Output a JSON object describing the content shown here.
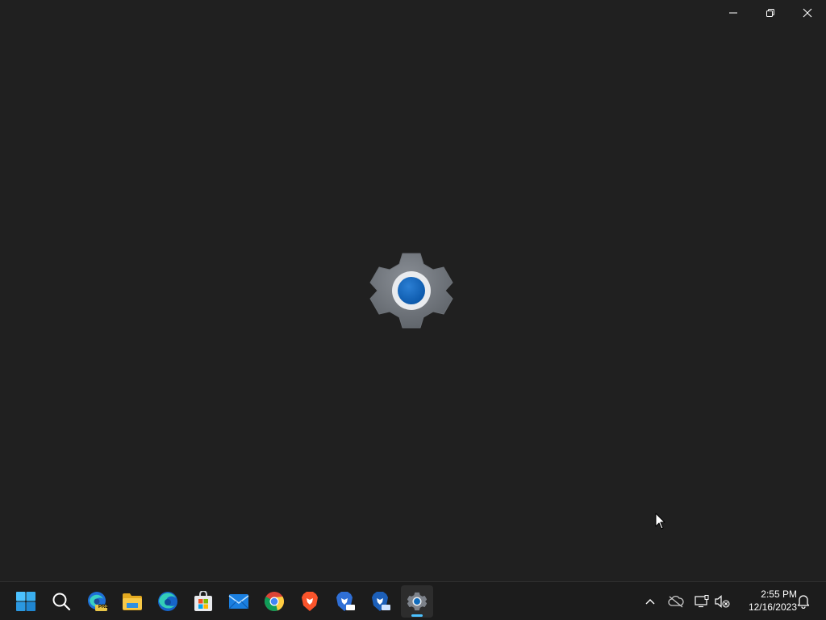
{
  "window": {
    "caption_buttons": [
      {
        "name": "minimize",
        "icon": "minimize-icon"
      },
      {
        "name": "restore",
        "icon": "restore-icon"
      },
      {
        "name": "close",
        "icon": "close-icon"
      }
    ],
    "splash_icon": "settings-gear-icon",
    "accent": "#0f6cbd"
  },
  "taskbar": {
    "apps": [
      {
        "name": "start",
        "icon": "windows-start-icon"
      },
      {
        "name": "search",
        "icon": "search-icon"
      },
      {
        "name": "edge-preview",
        "icon": "edge-preview-icon",
        "badge": "PRE"
      },
      {
        "name": "file-explorer",
        "icon": "folder-icon"
      },
      {
        "name": "edge",
        "icon": "edge-icon"
      },
      {
        "name": "store",
        "icon": "store-icon"
      },
      {
        "name": "mail",
        "icon": "mail-icon"
      },
      {
        "name": "chrome",
        "icon": "chrome-icon"
      },
      {
        "name": "brave",
        "icon": "brave-icon"
      },
      {
        "name": "brave-beta",
        "icon": "brave-beta-icon"
      },
      {
        "name": "brave-nightly",
        "icon": "brave-nightly-icon"
      },
      {
        "name": "settings",
        "icon": "settings-gear-icon",
        "active": true
      }
    ],
    "tray": {
      "icons": [
        "chevron-up-icon",
        "onedrive-offline-icon",
        "network-icon",
        "volume-muted-icon"
      ],
      "time": "2:55 PM",
      "date": "12/16/2023",
      "notification_icon": "bell-icon"
    },
    "active_indicator_color": "#4cc2ff"
  }
}
